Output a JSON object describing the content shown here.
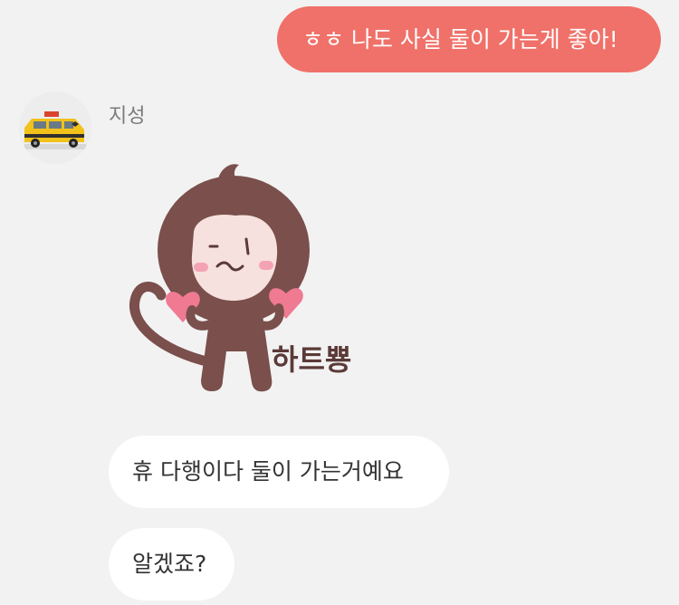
{
  "messages": {
    "outgoing": [
      {
        "text": "ㅎㅎ 나도 사실 둘이 가는게 좋아!"
      }
    ],
    "incoming": {
      "sender": "지성",
      "avatar": "yellow-toy-van-photo",
      "sticker": {
        "icon": "monkey-heart-sticker",
        "caption": "하트뿅"
      },
      "bubbles": [
        {
          "text": "휴 다행이다 둘이 가는거예요"
        },
        {
          "text": "알겠죠?"
        }
      ]
    }
  },
  "colors": {
    "background": "#f2f2f2",
    "outgoing_bubble": "#f07169",
    "incoming_bubble": "#ffffff",
    "sender_name": "#7a7a7a",
    "monkey_fur": "#7a4f4c",
    "heart": "#ef7a92"
  }
}
